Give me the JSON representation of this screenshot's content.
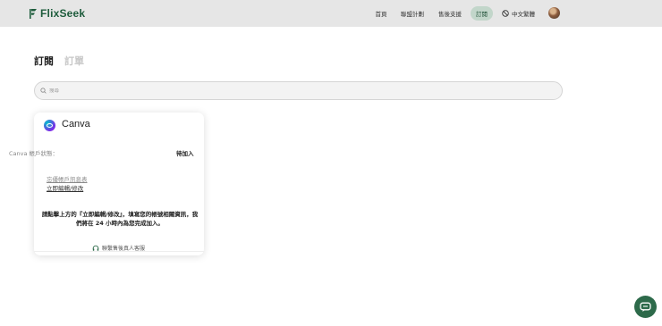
{
  "brand": {
    "name": "FlixSeek",
    "color": "#1e5c3c"
  },
  "nav": {
    "home": "首頁",
    "affiliate": "聯盟計劃",
    "support": "售後支援",
    "subscriptions": "訂閱",
    "language": "中文繁體",
    "language_icon": "globe-icon"
  },
  "tabs": {
    "subscriptions": "訂閱",
    "orders": "訂單"
  },
  "search": {
    "placeholder": "搜尋",
    "value": "",
    "icon": "search-icon"
  },
  "card": {
    "service": "Canva",
    "status_label": "Canva 帳戶狀態：",
    "status_value": "待加入",
    "link_info": "忘優帳戶訊息表",
    "link_edit": "立即編輯/修改",
    "instruction": "請點擊上方的『立即編輯/修改』，填寫您的帳號相關資訊，我們將在 24 小時內為您完成加入。",
    "support": "聯繫售後真人客服",
    "support_icon": "headset-icon"
  },
  "colors": {
    "accent": "#2d6a4a",
    "active_nav_bg": "#c2d6ca",
    "topbar_bg": "#e6e6e6"
  },
  "chat": {
    "icon": "chat-icon"
  }
}
